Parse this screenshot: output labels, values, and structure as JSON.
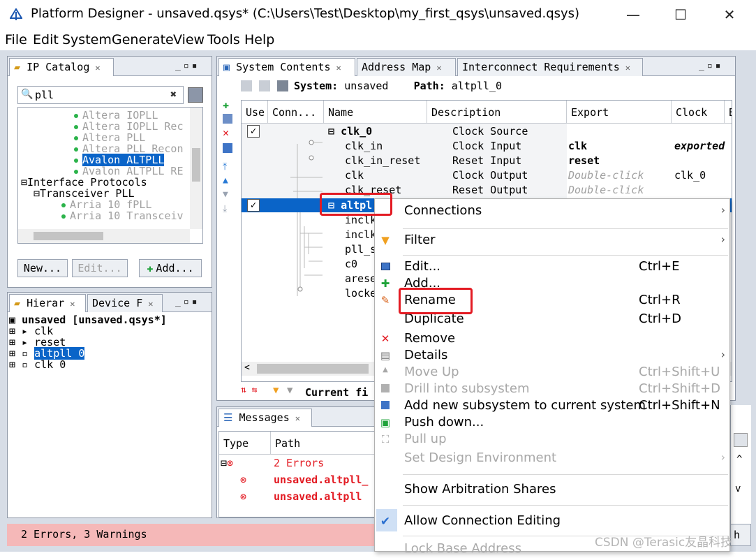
{
  "window": {
    "title": "Platform Designer - unsaved.qsys* (C:\\Users\\Test\\Desktop\\my_first_qsys\\unsaved.qsys)",
    "minimize": "—",
    "maximize": "☐",
    "close": "✕"
  },
  "menu": [
    "File",
    "Edit",
    "System",
    "Generate",
    "View",
    "Tools",
    "Help"
  ],
  "ip_catalog": {
    "tab": "IP Catalog",
    "search_value": "pll",
    "items": [
      {
        "label": "Altera IOPLL",
        "state": "dim"
      },
      {
        "label": "Altera IOPLL Rec",
        "state": "dim"
      },
      {
        "label": "Altera PLL",
        "state": "dim"
      },
      {
        "label": "Altera PLL Recon",
        "state": "dim"
      },
      {
        "label": "Avalon ALTPLL",
        "state": "selected"
      },
      {
        "label": "Avalon ALTPLL RE",
        "state": "dim"
      },
      {
        "label": "Interface Protocols",
        "state": "group"
      },
      {
        "label": "Transceiver PLL",
        "state": "group"
      },
      {
        "label": "Arria 10 fPLL",
        "state": "dim"
      },
      {
        "label": "Arria 10 Transceiv",
        "state": "dim"
      }
    ],
    "btn_new": "New...",
    "btn_edit": "Edit...",
    "btn_add": "Add..."
  },
  "hierarchy": {
    "tab1": "Hierar",
    "tab2": "Device F",
    "root": "unsaved [unsaved.qsys*]",
    "items": [
      {
        "label": "clk",
        "state": "normal"
      },
      {
        "label": "reset",
        "state": "normal"
      },
      {
        "label": "altpll 0",
        "state": "selected"
      },
      {
        "label": "clk 0",
        "state": "normal"
      }
    ]
  },
  "system_contents": {
    "tabs": [
      "System Contents",
      "Address Map",
      "Interconnect Requirements"
    ],
    "system_label": "System:",
    "system_value": "unsaved",
    "path_label": "Path:",
    "path_value": "altpll_0",
    "columns": [
      "Use",
      "Conn...",
      "Name",
      "Description",
      "Export",
      "Clock",
      "Base"
    ],
    "rows": [
      {
        "name": "clk_0",
        "desc": "Clock Source",
        "export": "",
        "clock": "",
        "bold": true,
        "check": true
      },
      {
        "name": "clk_in",
        "desc": "Clock Input",
        "export": "clk",
        "clock": "exported"
      },
      {
        "name": "clk_in_reset",
        "desc": "Reset Input",
        "export": "reset",
        "clock": ""
      },
      {
        "name": "clk",
        "desc": "Clock Output",
        "export": "Double-click",
        "clock": "clk_0"
      },
      {
        "name": "clk_reset",
        "desc": "Reset Output",
        "export": "Double-click",
        "clock": ""
      },
      {
        "name": "altpl",
        "desc": "",
        "export": "",
        "clock": "",
        "bold": true,
        "check": true,
        "selected": true
      },
      {
        "name": "inclk",
        "desc": "",
        "export": "",
        "clock": ""
      },
      {
        "name": "inclk",
        "desc": "",
        "export": "",
        "clock": ""
      },
      {
        "name": "pll_s",
        "desc": "",
        "export": "",
        "clock": ""
      },
      {
        "name": "c0",
        "desc": "",
        "export": "",
        "clock": ""
      },
      {
        "name": "arese",
        "desc": "",
        "export": "",
        "clock": ""
      },
      {
        "name": "locke",
        "desc": "",
        "export": "",
        "clock": ""
      }
    ],
    "filter_label": "Current fi"
  },
  "messages": {
    "tab": "Messages",
    "col_type": "Type",
    "col_path": "Path",
    "group": "2 Errors",
    "rows": [
      "unsaved.altpll_",
      "unsaved.altpll"
    ]
  },
  "context_menu": {
    "items": [
      {
        "label": "Connections",
        "shortcut": "",
        "icon": "none",
        "submenu": true,
        "disabled": false
      },
      {
        "label": "Filter",
        "shortcut": "",
        "icon": "filter-icon",
        "submenu": true,
        "disabled": false
      },
      {
        "label": "Edit...",
        "shortcut": "Ctrl+E",
        "icon": "edit-icon",
        "submenu": false,
        "disabled": false
      },
      {
        "label": "Add...",
        "shortcut": "",
        "icon": "add-icon",
        "submenu": false,
        "disabled": false
      },
      {
        "label": "Rename",
        "shortcut": "Ctrl+R",
        "icon": "pencil-icon",
        "submenu": false,
        "disabled": false
      },
      {
        "label": "Duplicate",
        "shortcut": "Ctrl+D",
        "icon": "none",
        "submenu": false,
        "disabled": false
      },
      {
        "label": "Remove",
        "shortcut": "",
        "icon": "remove-icon",
        "submenu": false,
        "disabled": false
      },
      {
        "label": "Details",
        "shortcut": "",
        "icon": "document-icon",
        "submenu": true,
        "disabled": false
      },
      {
        "label": "Move Up",
        "shortcut": "Ctrl+Shift+U",
        "icon": "arrow-up-icon",
        "submenu": false,
        "disabled": true
      },
      {
        "label": "Drill into subsystem",
        "shortcut": "Ctrl+Shift+D",
        "icon": "drill-icon",
        "submenu": false,
        "disabled": true
      },
      {
        "label": "Add new subsystem to current system",
        "shortcut": "Ctrl+Shift+N",
        "icon": "subsystem-icon",
        "submenu": false,
        "disabled": false
      },
      {
        "label": "Push down...",
        "shortcut": "",
        "icon": "push-down-icon",
        "submenu": false,
        "disabled": false
      },
      {
        "label": "Pull up",
        "shortcut": "",
        "icon": "pull-up-icon",
        "submenu": false,
        "disabled": true
      },
      {
        "label": "Set Design Environment",
        "shortcut": "",
        "icon": "none",
        "submenu": true,
        "disabled": true
      },
      {
        "label": "Show Arbitration Shares",
        "shortcut": "",
        "icon": "none",
        "submenu": false,
        "disabled": false
      },
      {
        "label": "Allow Connection Editing",
        "shortcut": "",
        "icon": "check-icon",
        "submenu": false,
        "disabled": false
      },
      {
        "label": "Lock Base Address",
        "shortcut": "",
        "icon": "none",
        "submenu": false,
        "disabled": true
      }
    ]
  },
  "status": {
    "text": "2 Errors, 3 Warnings",
    "right_fragment": "h"
  },
  "watermark": "CSDN @Terasic友晶科技",
  "colors": {
    "selection": "#0a64c8",
    "error": "#e31b23",
    "status_bg": "#f5b8b8"
  }
}
